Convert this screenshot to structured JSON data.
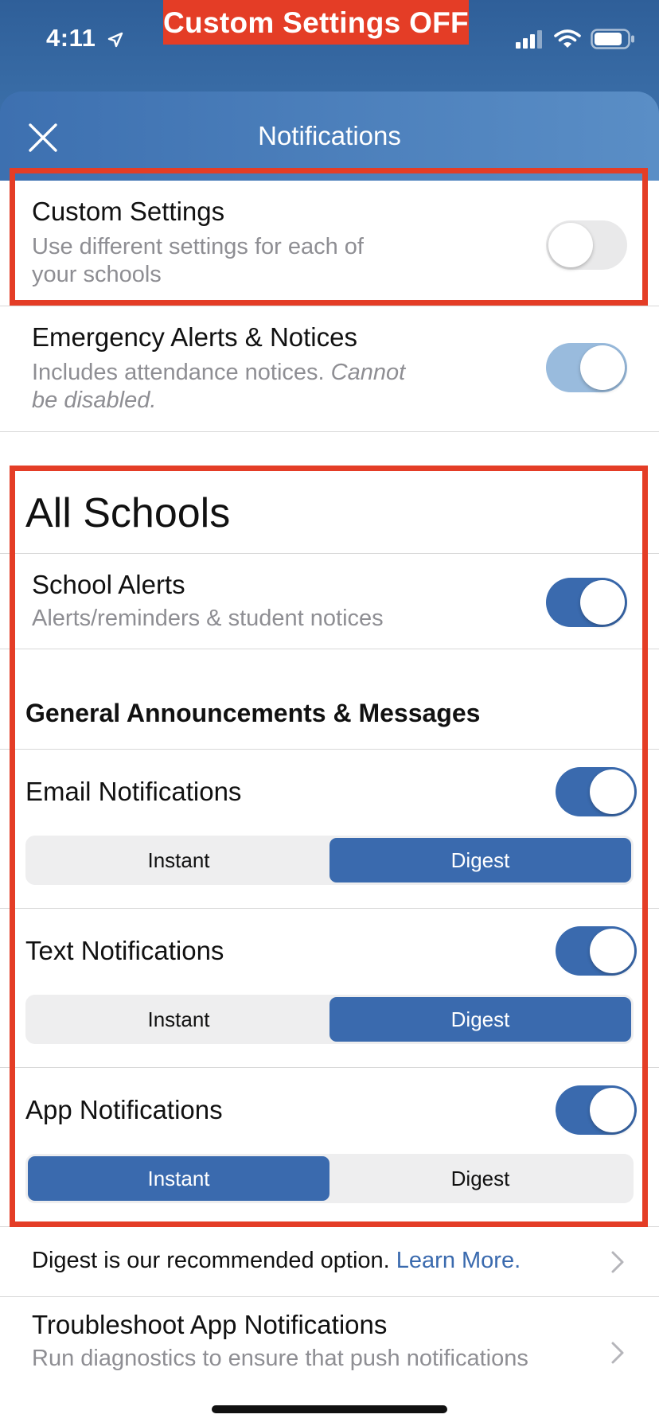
{
  "status_bar": {
    "time": "4:11"
  },
  "banner": {
    "text": "Custom Settings OFF"
  },
  "header": {
    "title": "Notifications"
  },
  "custom_settings": {
    "title": "Custom Settings",
    "subtitle_1": "Use different settings for each of",
    "subtitle_2": "your schools",
    "enabled": false
  },
  "emergency": {
    "title": "Emergency Alerts & Notices",
    "subtitle_1": "Includes attendance notices. ",
    "subtitle_italic_1": "Cannot",
    "subtitle_italic_2": "be disabled.",
    "enabled": true
  },
  "all_schools": {
    "title": "All Schools"
  },
  "school_alerts": {
    "title": "School Alerts",
    "subtitle": "Alerts/reminders & student notices",
    "enabled": true
  },
  "general": {
    "title": "General Announcements & Messages"
  },
  "email": {
    "title": "Email Notifications",
    "enabled": true,
    "option_instant": "Instant",
    "option_digest": "Digest",
    "selected": "Digest"
  },
  "text": {
    "title": "Text Notifications",
    "enabled": true,
    "option_instant": "Instant",
    "option_digest": "Digest",
    "selected": "Digest"
  },
  "app": {
    "title": "App Notifications",
    "enabled": true,
    "option_instant": "Instant",
    "option_digest": "Digest",
    "selected": "Instant"
  },
  "digest_info": {
    "text": "Digest is our recommended option. ",
    "link": "Learn More."
  },
  "troubleshoot": {
    "title": "Troubleshoot App Notifications",
    "subtitle": "Run diagnostics to ensure that push notifications"
  },
  "colors": {
    "accent": "#3a6aae",
    "highlight": "#e43d26",
    "link": "#3a6aae"
  }
}
